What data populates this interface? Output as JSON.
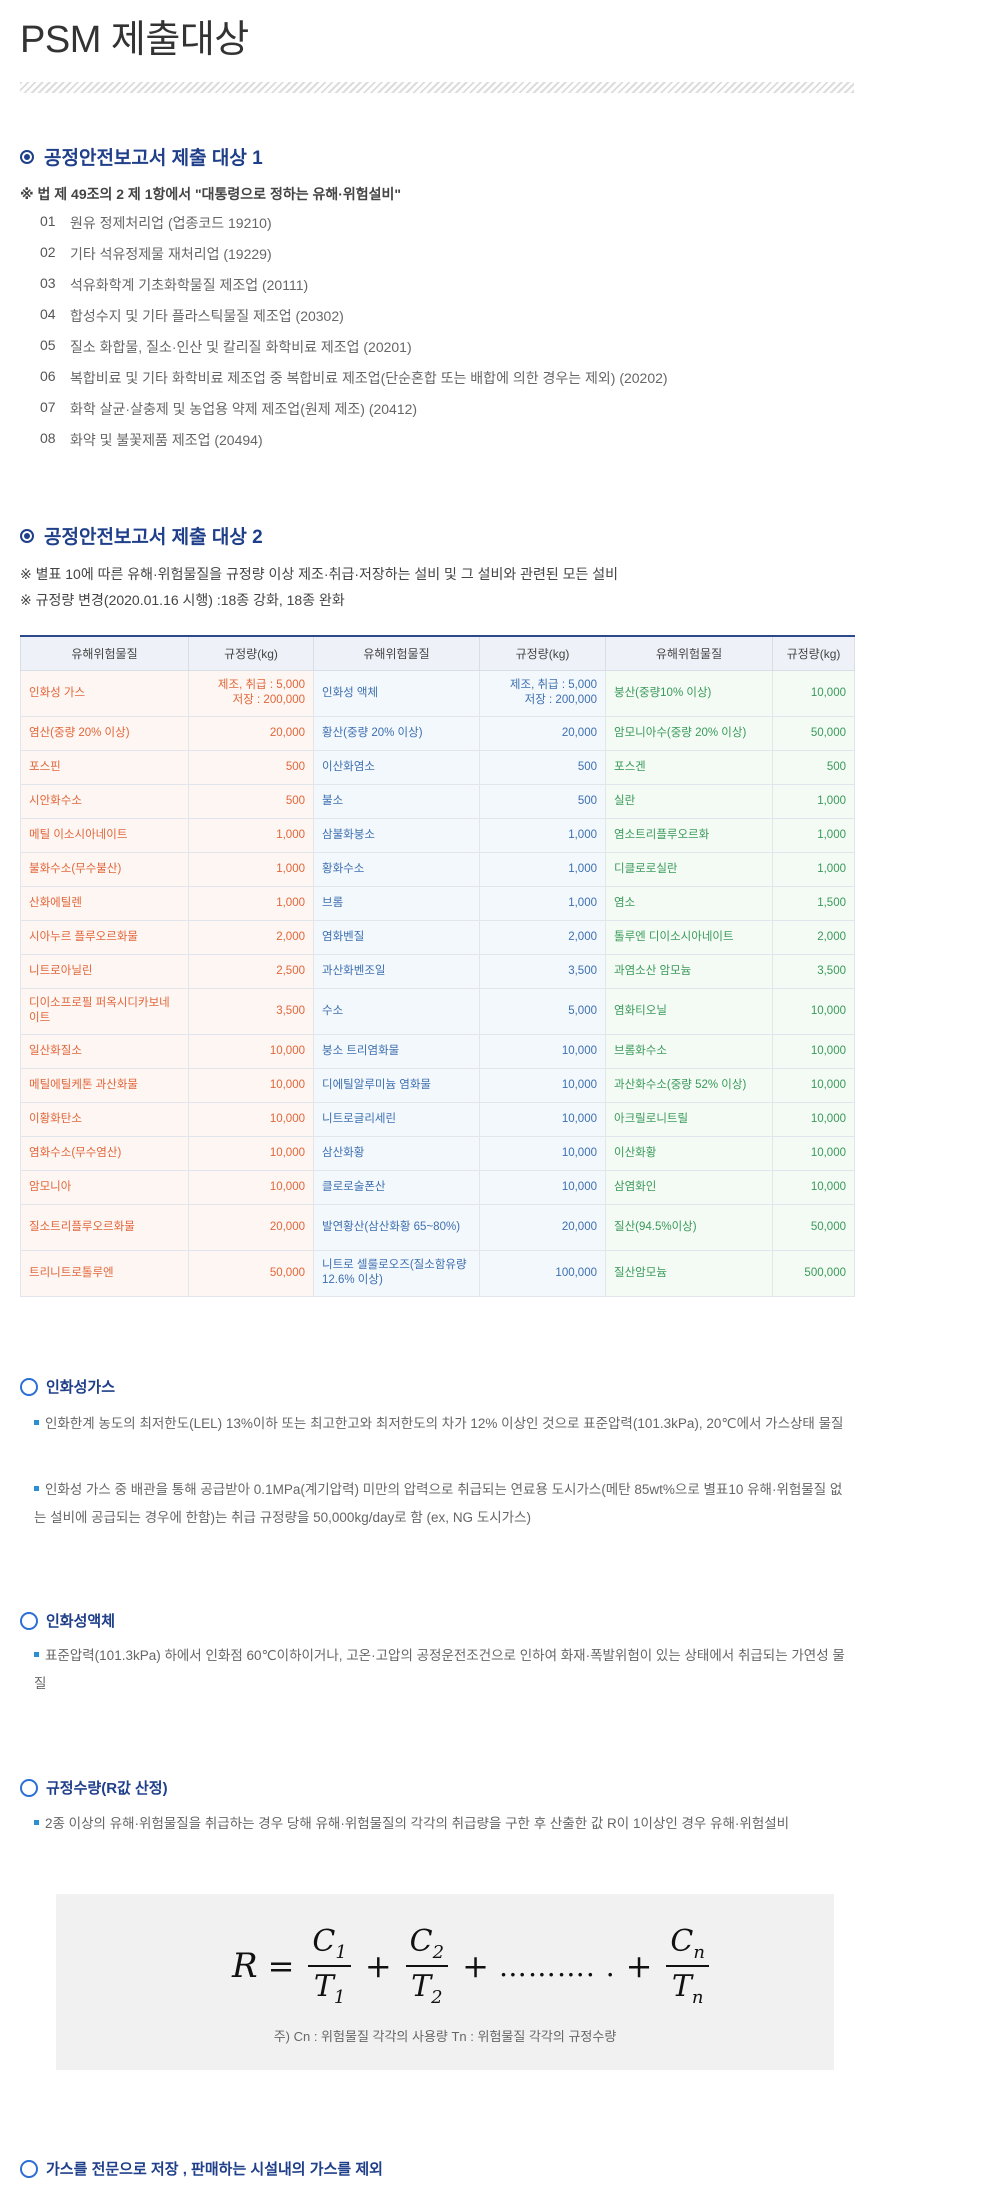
{
  "page_title": "PSM 제출대상",
  "section1": {
    "heading": "공정안전보고서 제출 대상 1",
    "note": "※  법 제 49조의 2 제 1항에서 \"대통령으로 정하는 유해·위험설비\"",
    "items": [
      {
        "num": "01",
        "text": "원유 정제처리업 (업종코드 19210)"
      },
      {
        "num": "02",
        "text": "기타 석유정제물 재처리업 (19229)"
      },
      {
        "num": "03",
        "text": "석유화학계 기초화학물질 제조업 (20111)"
      },
      {
        "num": "04",
        "text": "합성수지 및 기타 플라스틱물질 제조업 (20302)"
      },
      {
        "num": "05",
        "text": "질소 화합물, 질소·인산 및 칼리질 화학비료 제조업 (20201)"
      },
      {
        "num": "06",
        "text": "복합비료 및 기타 화학비료 제조업 중 복합비료 제조업(단순혼합 또는 배합에 의한 경우는 제외) (20202)"
      },
      {
        "num": "07",
        "text": "화학 살균·살충제 및 농업용 약제 제조업(원제 제조) (20412)"
      },
      {
        "num": "08",
        "text": "화약 및 불꽃제품 제조업 (20494)"
      }
    ]
  },
  "section2": {
    "heading": "공정안전보고서 제출 대상 2",
    "note1": "※  별표 10에 따른 유해·위험물질을 규정량 이상 제조·취급·저장하는 설비 및 그 설비와 관련된 모든 설비",
    "note2": "※  규정량 변경(2020.01.16 시행) :18종 강화, 18종 완화"
  },
  "table": {
    "headers": [
      "유해위험물질",
      "규정량(kg)",
      "유해위험물질",
      "규정량(kg)",
      "유해위험물질",
      "규정량(kg)"
    ],
    "rows": [
      [
        "인화성 가스",
        "제조, 취급 : 5,000\n저장 : 200,000",
        "인화성 액체",
        "제조, 취급 : 5,000\n저장 : 200,000",
        "붕산(중량10% 이상)",
        "10,000"
      ],
      [
        "염산(중량 20% 이상)",
        "20,000",
        "황산(중량 20% 이상)",
        "20,000",
        "암모니아수(중량 20% 이상)",
        "50,000"
      ],
      [
        "포스핀",
        "500",
        "이산화염소",
        "500",
        "포스겐",
        "500"
      ],
      [
        "시안화수소",
        "500",
        "불소",
        "500",
        "실란",
        "1,000"
      ],
      [
        "메틸 이소시아네이트",
        "1,000",
        "삼불화붕소",
        "1,000",
        "염소트리플루오르화",
        "1,000"
      ],
      [
        "불화수소(무수불산)",
        "1,000",
        "황화수소",
        "1,000",
        "디클로로실란",
        "1,000"
      ],
      [
        "산화에틸렌",
        "1,000",
        "브롬",
        "1,000",
        "염소",
        "1,500"
      ],
      [
        "시아누르 플루오르화물",
        "2,000",
        "염화벤질",
        "2,000",
        "톨루엔 디이소시아네이트",
        "2,000"
      ],
      [
        "니트로아닐린",
        "2,500",
        "과산화벤조일",
        "3,500",
        "과염소산 암모늄",
        "3,500"
      ],
      [
        "디이소프로필 퍼옥시디카보네이트",
        "3,500",
        "수소",
        "5,000",
        "염화티오닐",
        "10,000"
      ],
      [
        "일산화질소",
        "10,000",
        "붕소 트리염화물",
        "10,000",
        "브롬화수소",
        "10,000"
      ],
      [
        "메틸에틸케톤 과산화물",
        "10,000",
        "디에틸알루미늄 염화물",
        "10,000",
        "과산화수소(중량 52% 이상)",
        "10,000"
      ],
      [
        "이황화탄소",
        "10,000",
        "니트로글리세린",
        "10,000",
        "아크릴로니트릴",
        "10,000"
      ],
      [
        "염화수소(무수염산)",
        "10,000",
        "삼산화황",
        "10,000",
        "이산화황",
        "10,000"
      ],
      [
        "암모니아",
        "10,000",
        "클로로술폰산",
        "10,000",
        "삼염화인",
        "10,000"
      ],
      [
        "질소트리플루오르화물",
        "20,000",
        "발연황산(삼산화황 65~80%)",
        "20,000",
        "질산(94.5%이상)",
        "50,000"
      ],
      [
        "트리니트로톨루엔",
        "50,000",
        "니트로 셀룰로오즈(질소함유량 12.6% 이상)",
        "100,000",
        "질산암모늄",
        "500,000"
      ]
    ]
  },
  "flammable_gas": {
    "heading": "인화성가스",
    "p1": "인화한계 농도의 최저한도(LEL) 13%이하 또는 최고한고와 최저한도의 차가 12% 이상인 것으로 표준압력(101.3kPa), 20℃에서 가스상태 물질",
    "p2": "인화성 가스 중 배관을 통해 공급받아 0.1MPa(계기압력) 미만의 압력으로 취급되는 연료용 도시가스(메탄 85wt%으로 별표10 유해·위험물질 없는 설비에 공급되는 경우에 한함)는 취급 규정량을 50,000kg/day로 함 (ex, NG 도시가스)"
  },
  "flammable_liquid": {
    "heading": "인화성액체",
    "p1": "표준압력(101.3kPa) 하에서 인화점 60℃이하이거나, 고온·고압의 공정운전조건으로 인하여 화재·폭발위험이 있는 상태에서 취급되는 가연성 물질"
  },
  "r_value": {
    "heading": "규정수량(R값 산정)",
    "p1": "2종 이상의 유해·위험물질을 취급하는 경우 당해 유해·위험물질의 각각의 취급량을 구한 후 산출한 값 R이 1이상인 경우 유해·위험설비",
    "formula": {
      "lhs": "R",
      "eq": "=",
      "plus": "+",
      "dots": "………. .",
      "terms": [
        {
          "num": "C",
          "num_sub": "1",
          "den": "T",
          "den_sub": "1"
        },
        {
          "num": "C",
          "num_sub": "2",
          "den": "T",
          "den_sub": "2"
        },
        {
          "num": "C",
          "num_sub": "n",
          "den": "T",
          "den_sub": "n"
        }
      ]
    },
    "note": "주) Cn : 위험물질 각각의 사용량 Tn : 위험물질 각각의 규정수량"
  },
  "gas_exclusion": {
    "heading": "가스를 전문으로 저장 , 판매하는 시설내의 가스를 제외"
  }
}
